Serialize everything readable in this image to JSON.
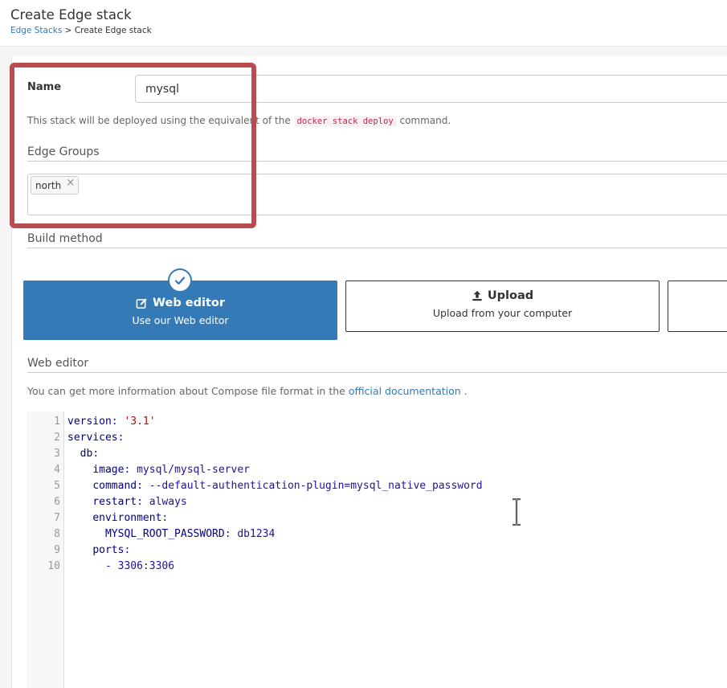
{
  "header": {
    "title": "Create Edge stack",
    "breadcrumb_link": "Edge Stacks",
    "breadcrumb_sep": ">",
    "breadcrumb_current": "Create Edge stack"
  },
  "form": {
    "name_label": "Name",
    "name_value": "mysql",
    "hint_prefix": "This stack will be deployed using the equivalent of the",
    "hint_code": "docker stack deploy",
    "hint_suffix": "command.",
    "edge_groups_title": "Edge Groups",
    "edge_groups": [
      "north"
    ],
    "build_method_title": "Build method"
  },
  "build_methods": [
    {
      "title": "Web editor",
      "subtitle": "Use our Web editor",
      "selected": true
    },
    {
      "title": "Upload",
      "subtitle": "Upload from your computer",
      "selected": false
    }
  ],
  "web_editor": {
    "title": "Web editor",
    "hint_prefix": "You can get more information about Compose file format in the",
    "hint_link": "official documentation",
    "hint_suffix": "."
  },
  "code_lines": [
    "version: '3.1'",
    "services:",
    "  db:",
    "    image: mysql/mysql-server",
    "    command: --default-authentication-plugin=mysql_native_password",
    "    restart: always",
    "    environment:",
    "      MYSQL_ROOT_PASSWORD: db1234",
    "    ports:",
    "      - 3306:3306"
  ],
  "colors": {
    "accent": "#337ab7",
    "highlight_border": "#b84c4f"
  }
}
